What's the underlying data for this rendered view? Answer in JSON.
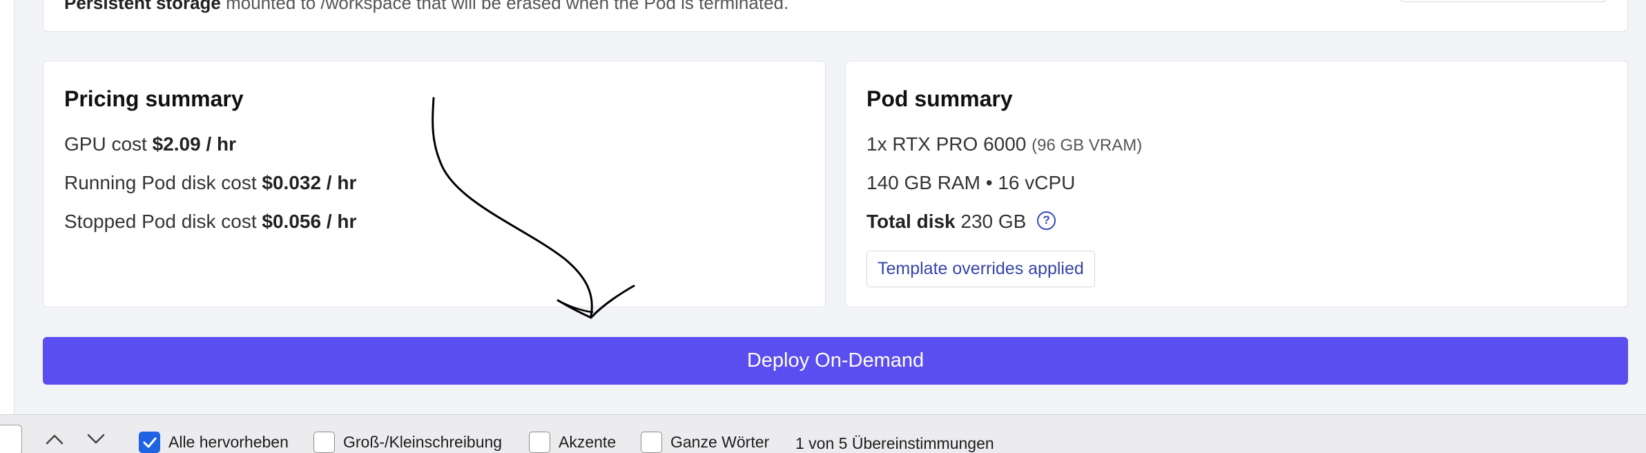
{
  "top_card": {
    "bold_text": "Persistent storage",
    "text": " mounted to /workspace that will be erased when the Pod is terminated."
  },
  "pricing": {
    "title": "Pricing summary",
    "gpu_label": "GPU cost",
    "gpu_value": "$2.09 / hr",
    "running_label": "Running Pod disk cost",
    "running_value": "$0.032 / hr",
    "stopped_label": "Stopped Pod disk cost",
    "stopped_value": "$0.056 / hr"
  },
  "pod": {
    "title": "Pod summary",
    "gpu": "1x RTX PRO 6000",
    "vram": "(96 GB VRAM)",
    "ram_cpu": "140 GB RAM • 16 vCPU",
    "total_disk_label": "Total disk",
    "total_disk_value": "230 GB",
    "badge": "Template overrides applied"
  },
  "deploy_button": "Deploy On-Demand",
  "findbar": {
    "options": [
      {
        "label": "Alle hervorheben",
        "checked": true
      },
      {
        "label": "Groß-/Kleinschreibung",
        "checked": false
      },
      {
        "label": "Akzente",
        "checked": false
      },
      {
        "label": "Ganze Wörter",
        "checked": false
      }
    ],
    "match_count": "1 von 5 Übereinstimmungen"
  },
  "icons": {
    "help": "question-circle-icon",
    "prev": "chevron-up-icon",
    "next": "chevron-down-icon",
    "check": "checkmark-icon"
  },
  "colors": {
    "accent": "#5b4ef0",
    "link": "#2f49b8",
    "checkbox_checked": "#1f63e3"
  }
}
